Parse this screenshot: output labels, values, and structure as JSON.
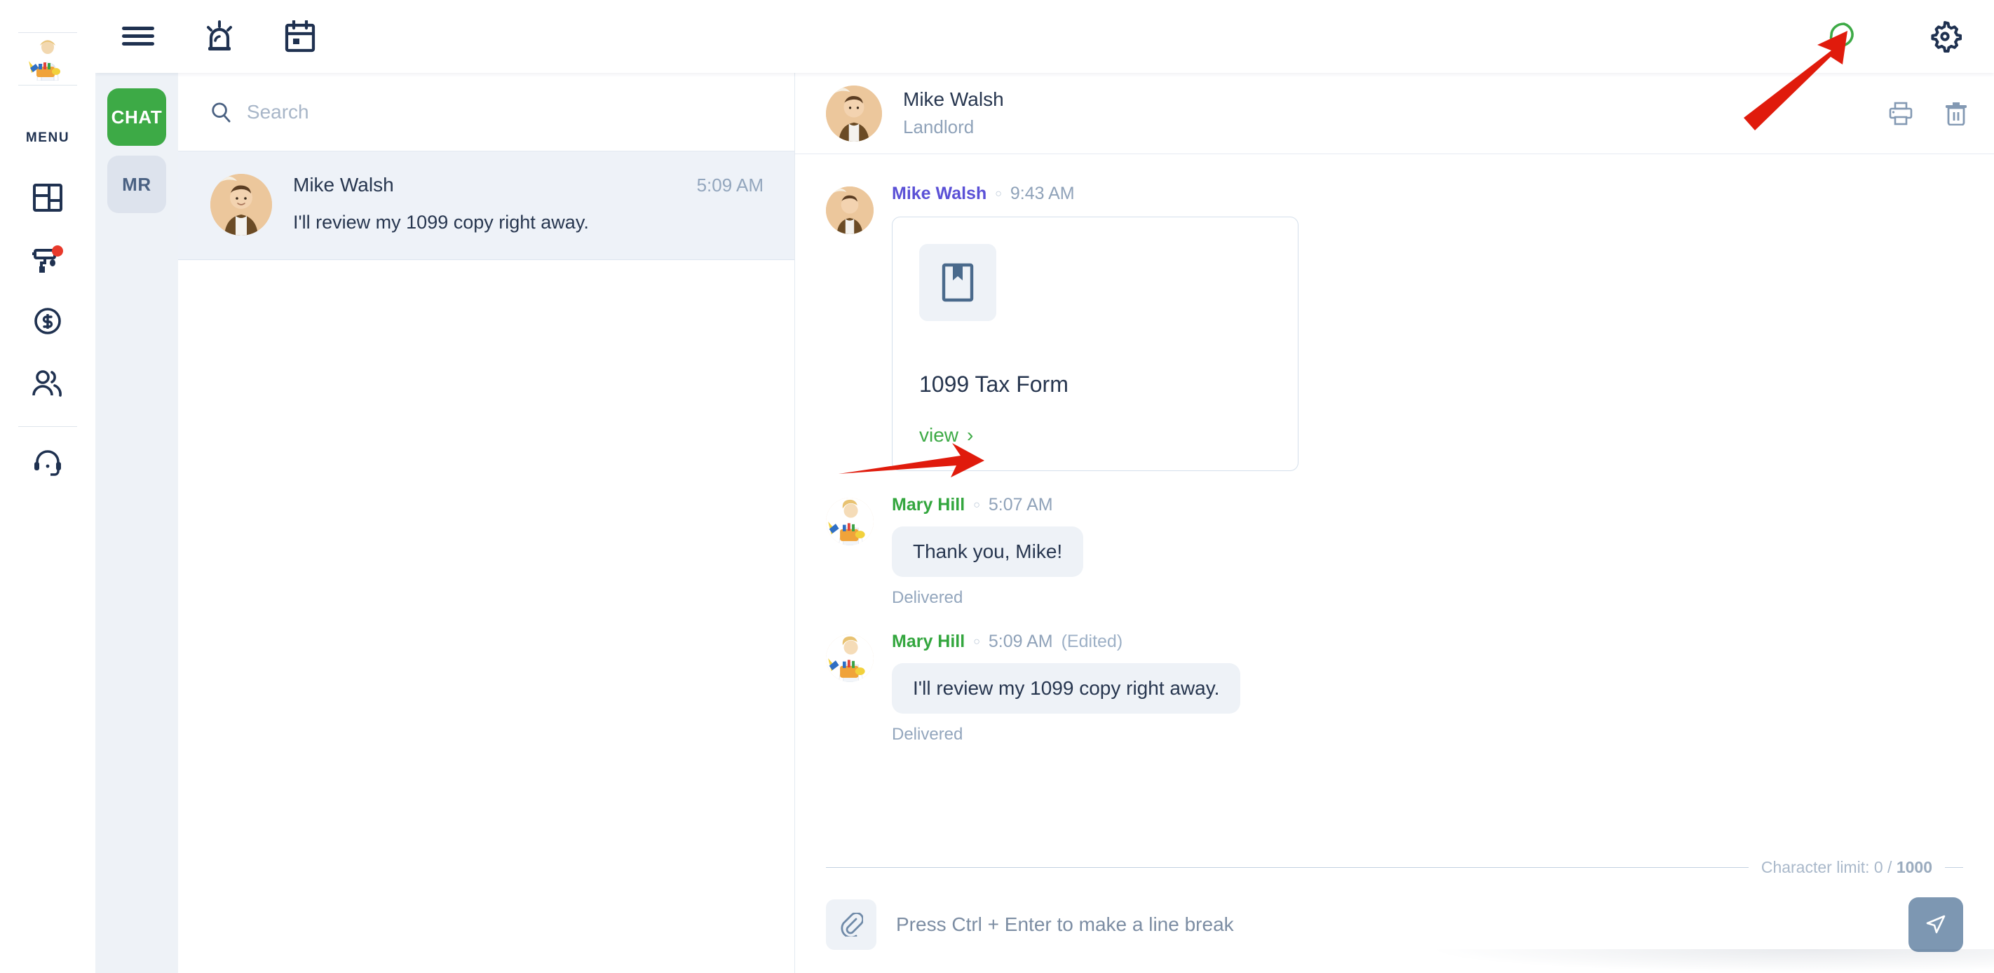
{
  "rail": {
    "menu_label": "MENU",
    "items": [
      {
        "name": "dashboard",
        "icon": "dashboard-grid-icon",
        "badge": false
      },
      {
        "name": "maintenance",
        "icon": "paint-roller-icon",
        "badge": true
      },
      {
        "name": "payments",
        "icon": "dollar-coin-icon",
        "badge": false
      },
      {
        "name": "tenants",
        "icon": "users-icon",
        "badge": false
      },
      {
        "name": "support",
        "icon": "headset-icon",
        "badge": false
      }
    ]
  },
  "topbar": {
    "left_icons": [
      {
        "name": "hamburger-menu-icon"
      },
      {
        "name": "alarm-siren-icon"
      },
      {
        "name": "calendar-icon"
      }
    ],
    "right_icons": [
      {
        "name": "chat-bubble-icon",
        "color": "#3daa46"
      },
      {
        "name": "gear-icon",
        "color": "#1f3150"
      }
    ]
  },
  "tabs": [
    {
      "label": "CHAT",
      "active": true
    },
    {
      "label": "MR",
      "active": false
    }
  ],
  "search": {
    "placeholder": "Search",
    "value": ""
  },
  "conversations": [
    {
      "name": "Mike Walsh",
      "time": "5:09 AM",
      "preview": "I'll review my 1099 copy right away.",
      "selected": true
    }
  ],
  "chat_header": {
    "name": "Mike Walsh",
    "role": "Landlord",
    "actions": [
      {
        "name": "print-icon"
      },
      {
        "name": "trash-icon"
      }
    ]
  },
  "messages": [
    {
      "author": "Mike Walsh",
      "author_color_class": "mike",
      "separator": "○",
      "time": "9:43 AM",
      "edited": "",
      "type": "document_card",
      "card": {
        "icon": "bookmark-document-icon",
        "title": "1099 Tax Form",
        "action_label": "view",
        "action_chevron": "›"
      },
      "status": ""
    },
    {
      "author": "Mary Hill",
      "author_color_class": "mary",
      "separator": "○",
      "time": "5:07 AM",
      "edited": "",
      "type": "text",
      "text": "Thank you, Mike!",
      "status": "Delivered"
    },
    {
      "author": "Mary Hill",
      "author_color_class": "mary",
      "separator": "○",
      "time": "5:09 AM",
      "edited": "(Edited)",
      "type": "text",
      "text": "I'll review my 1099 copy right away.",
      "status": "Delivered"
    }
  ],
  "composer": {
    "char_limit_prefix": "Character limit: 0 / ",
    "char_limit_max": "1000",
    "placeholder": "Press Ctrl + Enter to make a line break",
    "value": "",
    "attach_icon": "paperclip-icon",
    "send_icon": "send-paper-plane-icon"
  },
  "annotations": [
    {
      "name": "arrow-to-chat-bubble-icon",
      "color": "#e01b0c"
    },
    {
      "name": "arrow-to-view-link",
      "color": "#e01b0c"
    }
  ],
  "colors": {
    "accent_green": "#3daa46",
    "navy": "#1f3150",
    "panel_bg": "#eef2f7",
    "send_btn": "#7d97b2",
    "annotation_red": "#e01b0c"
  }
}
